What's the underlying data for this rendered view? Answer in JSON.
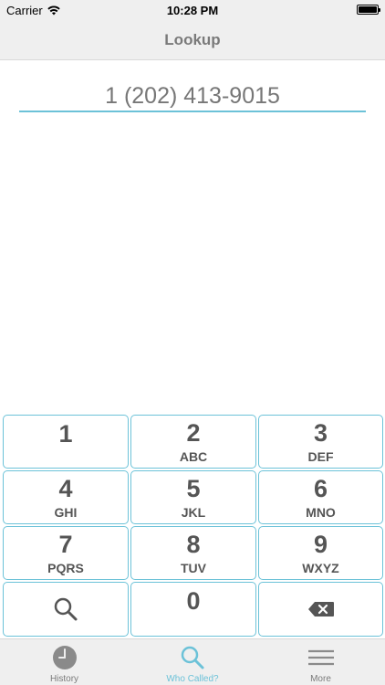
{
  "status_bar": {
    "carrier": "Carrier",
    "time": "10:28 PM"
  },
  "nav": {
    "title": "Lookup"
  },
  "display": {
    "number": "1 (202) 413-9015"
  },
  "keypad": {
    "keys": [
      {
        "digit": "1",
        "letters": ""
      },
      {
        "digit": "2",
        "letters": "ABC"
      },
      {
        "digit": "3",
        "letters": "DEF"
      },
      {
        "digit": "4",
        "letters": "GHI"
      },
      {
        "digit": "5",
        "letters": "JKL"
      },
      {
        "digit": "6",
        "letters": "MNO"
      },
      {
        "digit": "7",
        "letters": "PQRS"
      },
      {
        "digit": "8",
        "letters": "TUV"
      },
      {
        "digit": "9",
        "letters": "WXYZ"
      },
      {
        "digit": "0",
        "letters": ""
      }
    ],
    "search_icon": "search-icon",
    "delete_icon": "backspace-icon"
  },
  "tabs": [
    {
      "label": "History",
      "icon": "clock-icon",
      "active": false
    },
    {
      "label": "Who Called?",
      "icon": "search-icon",
      "active": true
    },
    {
      "label": "More",
      "icon": "menu-icon",
      "active": false
    }
  ],
  "colors": {
    "accent": "#6cc2d8",
    "bar_background": "#efefef",
    "key_text": "#555555"
  }
}
